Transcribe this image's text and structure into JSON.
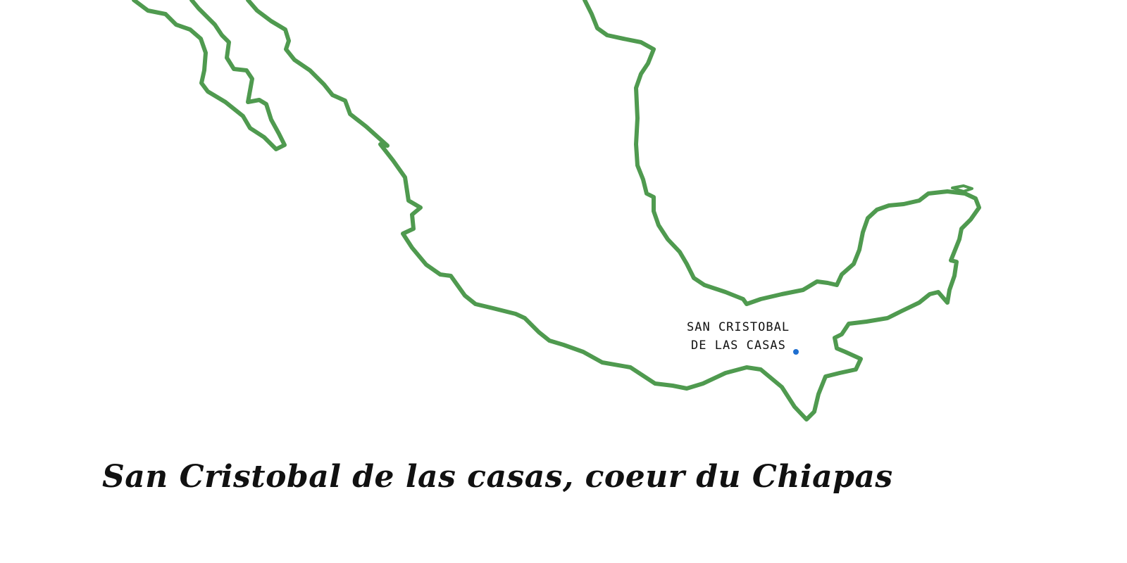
{
  "map": {
    "outline_color": "#4f9a4f",
    "marker_color": "#1f6fd0",
    "background_color": "#ffffff"
  },
  "city": {
    "label_line1": "SAN CRISTOBAL",
    "label_line2": "DE LAS CASAS"
  },
  "caption": "San Cristobal de las casas, coeur du Chiapas"
}
